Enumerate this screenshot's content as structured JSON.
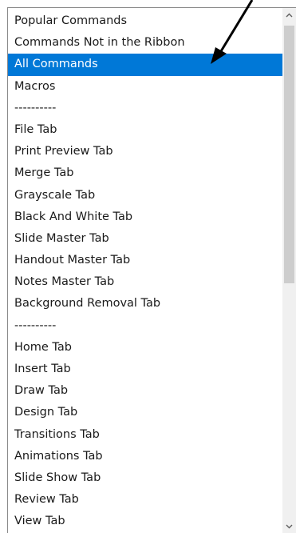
{
  "listbox": {
    "items": [
      {
        "label": "Popular Commands"
      },
      {
        "label": "Commands Not in the Ribbon"
      },
      {
        "label": "All Commands",
        "selected": true
      },
      {
        "label": "Macros"
      },
      {
        "label": "----------"
      },
      {
        "label": "File Tab"
      },
      {
        "label": "Print Preview Tab"
      },
      {
        "label": "Merge Tab"
      },
      {
        "label": "Grayscale Tab"
      },
      {
        "label": "Black And White Tab"
      },
      {
        "label": "Slide Master Tab"
      },
      {
        "label": "Handout Master Tab"
      },
      {
        "label": "Notes Master Tab"
      },
      {
        "label": "Background Removal Tab"
      },
      {
        "label": "----------"
      },
      {
        "label": "Home Tab"
      },
      {
        "label": "Insert Tab"
      },
      {
        "label": "Draw Tab"
      },
      {
        "label": "Design Tab"
      },
      {
        "label": "Transitions Tab"
      },
      {
        "label": "Animations Tab"
      },
      {
        "label": "Slide Show Tab"
      },
      {
        "label": "Review Tab"
      },
      {
        "label": "View Tab"
      }
    ]
  },
  "scrollbar": {
    "up_icon": "chevron-up-icon",
    "down_icon": "chevron-down-icon"
  },
  "colors": {
    "selection": "#0078d7",
    "selection_text": "#ffffff",
    "text": "#1a1a1a",
    "scrollbar_track": "#f0f0f0",
    "scrollbar_thumb": "#cdcdcd"
  }
}
